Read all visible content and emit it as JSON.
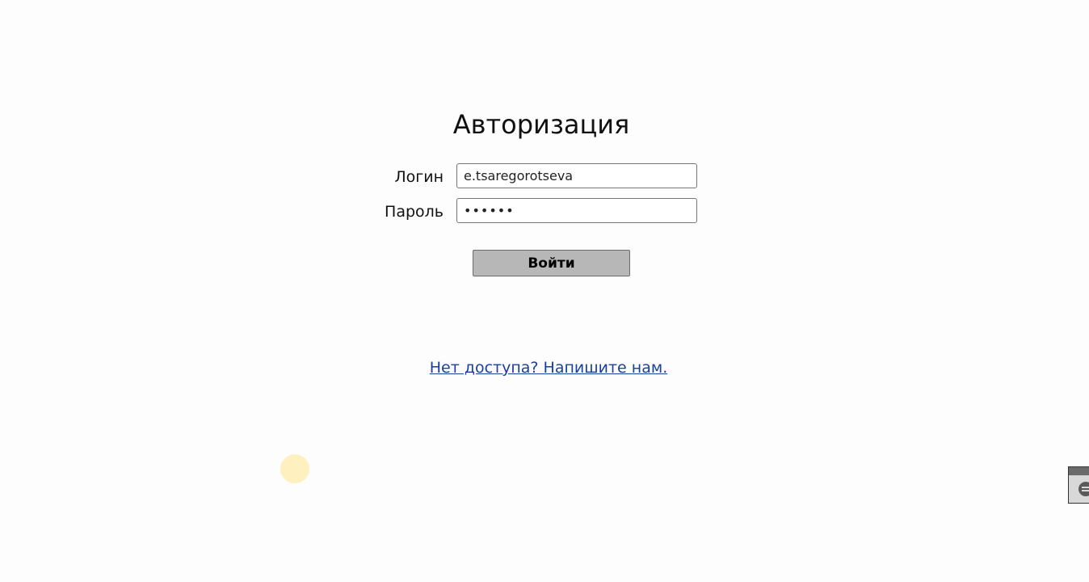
{
  "form": {
    "title": "Авторизация",
    "login_label": "Логин",
    "login_value": "e.tsaregorotseva",
    "password_label": "Пароль",
    "password_value": "••••••",
    "submit_label": "Войти"
  },
  "help": {
    "link_text": "Нет доступа? Напишите нам."
  },
  "widget": {
    "icon": "chat-icon"
  },
  "colors": {
    "link": "#1a3f9c",
    "button_bg": "#b7b7b7",
    "background": "#fdfdfd"
  }
}
